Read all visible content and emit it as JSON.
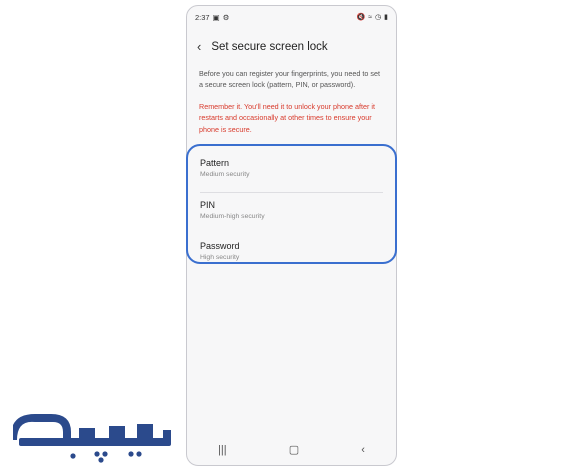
{
  "status_bar": {
    "time": "2:37",
    "left_icons": [
      "image-icon",
      "gear-icon"
    ],
    "right_icons": [
      "mute-icon",
      "wifi-icon",
      "alarm-icon",
      "battery-icon"
    ]
  },
  "header": {
    "title": "Set secure screen lock"
  },
  "intro_text": "Before you can register your fingerprints, you need to set a secure screen lock (pattern, PIN, or password).",
  "warning_text": "Remember it. You'll need it to unlock your phone after it restarts and occasionally at other times to ensure your phone is secure.",
  "options": [
    {
      "title": "Pattern",
      "subtitle": "Medium security"
    },
    {
      "title": "PIN",
      "subtitle": "Medium-high security"
    },
    {
      "title": "Password",
      "subtitle": "High security"
    }
  ],
  "colors": {
    "warning": "#d83a2c",
    "highlight": "#3a6fcf",
    "logo": "#2b4a8c"
  }
}
